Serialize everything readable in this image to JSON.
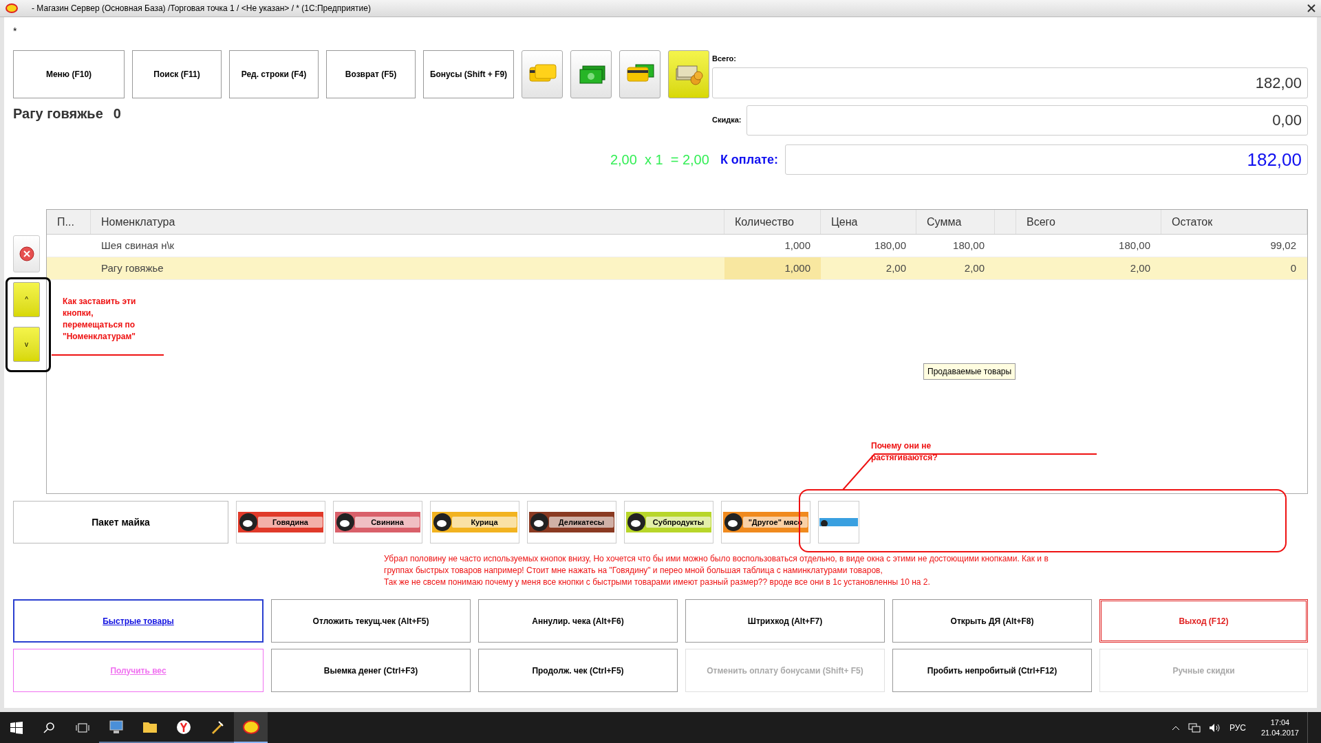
{
  "window": {
    "title": "- Магазин Сервер (Основная База) /Торговая точка 1 / <Не указан> / * (1С:Предприятие)"
  },
  "modified_mark": "*",
  "toolbar": {
    "buttons": [
      {
        "label": "Меню (F10)"
      },
      {
        "label": "Поиск (F11)"
      },
      {
        "label": "Ред. строки (F4)"
      },
      {
        "label": "Возврат (F5)"
      },
      {
        "label": "Бонусы (Shift + F9)"
      }
    ],
    "payment_buttons": [
      {
        "kind": "card",
        "selected": false
      },
      {
        "kind": "cash",
        "selected": false
      },
      {
        "kind": "mixed",
        "selected": false
      },
      {
        "kind": "coins",
        "selected": true
      }
    ]
  },
  "current_item": {
    "name": "Рагу говяжье",
    "stock": "0",
    "formula": "2,00  x 1  = 2,00"
  },
  "totals": {
    "total_label": "Всего:",
    "total": "182,00",
    "discount_label": "Скидка:",
    "discount": "0,00",
    "pay_label": "К оплате:",
    "pay": "182,00"
  },
  "table": {
    "columns": [
      "П...",
      "Номенклатура",
      "Количество",
      "Цена",
      "Сумма",
      "Всего",
      "Остаток"
    ],
    "rows": [
      {
        "cells": [
          "",
          "Шея свиная н\\к",
          "1,000",
          "180,00",
          "180,00",
          "180,00",
          "99,02"
        ],
        "selected": false
      },
      {
        "cells": [
          "",
          "Рагу говяжье",
          "1,000",
          "2,00",
          "2,00",
          "2,00",
          "0"
        ],
        "selected": true
      }
    ]
  },
  "nav_buttons": [
    "^",
    "v"
  ],
  "tooltip": "Продаваемые товары",
  "annotation_left": [
    "Как заставить эти",
    "кнопки,",
    "перемещаться по",
    "\"Номенклатурам\""
  ],
  "annotation_right": [
    "Почему они не",
    "растягиваются?"
  ],
  "quick_goods": {
    "package": "Пакет майка",
    "groups": [
      {
        "label": "Говядина",
        "color": "#e03a2a"
      },
      {
        "label": "Свинина",
        "color": "#d9606a"
      },
      {
        "label": "Курица",
        "color": "#f2b320"
      },
      {
        "label": "Деликатесы",
        "color": "#8a3a22"
      },
      {
        "label": "Субпродукты",
        "color": "#b8d62a"
      },
      {
        "label": "\"Другое\" мясо",
        "color": "#f08a1e"
      }
    ]
  },
  "annotation_bottom": [
    "Убрал половину не часто используемых кнопок внизу, Но хочется что бы ими можно было воспользоваться отдельно, в виде окна с этими не достоющими кнопками. Как и в",
    "группах быстрых товаров например! Стоит мне нажать на \"Говядину\" и перео мной большая таблица с наминклатурами товаров,",
    "Так же не свсем понимаю почему у меня все кнопки с быстрыми товарами имеют разный размер?? вроде все они в 1с установленны 10 на 2."
  ],
  "actions": [
    {
      "label": "Быстрые товары",
      "kind": "link"
    },
    {
      "label": "Отложить текущ.чек (Alt+F5)",
      "kind": "plain"
    },
    {
      "label": "Аннулир. чека (Alt+F6)",
      "kind": "plain"
    },
    {
      "label": "Штрихкод (Alt+F7)",
      "kind": "plain"
    },
    {
      "label": "Открыть ДЯ (Alt+F8)",
      "kind": "plain"
    },
    {
      "label": "Выход (F12)",
      "kind": "exit"
    },
    {
      "label": "Получить вес",
      "kind": "weigh"
    },
    {
      "label": "Выемка денег (Ctrl+F3)",
      "kind": "plain"
    },
    {
      "label": "Продолж. чек (Ctrl+F5)",
      "kind": "plain"
    },
    {
      "label": "Отменить оплату бонусами (Shift+ F5)",
      "kind": "disabled"
    },
    {
      "label": "Пробить непробитый (Ctrl+F12)",
      "kind": "plain"
    },
    {
      "label": "Ручные скидки",
      "kind": "disabled"
    }
  ],
  "taskbar": {
    "apps": [
      {
        "kind": "computer",
        "active": false
      },
      {
        "kind": "folder",
        "active": false
      },
      {
        "kind": "browser",
        "active": false
      },
      {
        "kind": "tool",
        "active": false
      },
      {
        "kind": "onec",
        "active": true
      }
    ],
    "language": "РУС",
    "time": "17:04",
    "date": "21.04.2017"
  }
}
